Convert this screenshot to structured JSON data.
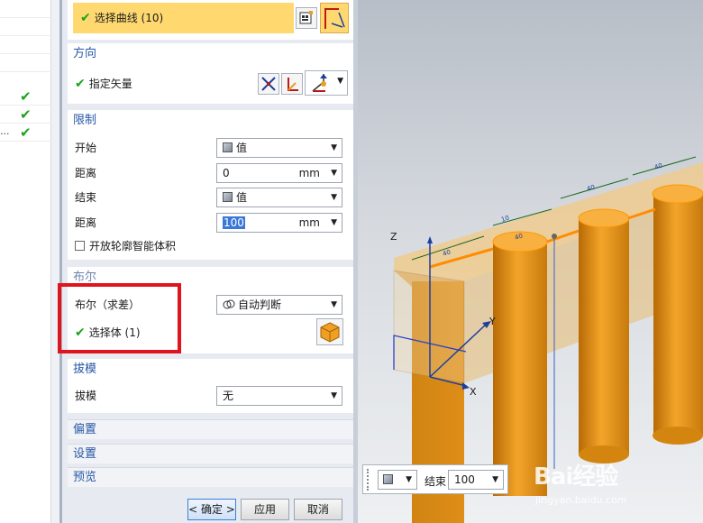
{
  "left_list": {
    "rows": [
      {
        "check": false,
        "text": ""
      },
      {
        "check": false,
        "text": ""
      },
      {
        "check": false,
        "text": ""
      },
      {
        "check": false,
        "text": ""
      },
      {
        "check": true,
        "text": ""
      },
      {
        "check": true,
        "text": ""
      },
      {
        "check": true,
        "text": "..."
      }
    ]
  },
  "section_top": {
    "select_curve_label": "选择曲线 (10)"
  },
  "direction": {
    "title": "方向",
    "specify_vector_label": "指定矢量"
  },
  "limits": {
    "title": "限制",
    "start_label": "开始",
    "start_value": "值",
    "distance1_label": "距离",
    "distance1_value": "0",
    "distance1_unit": "mm",
    "end_label": "结束",
    "end_value": "值",
    "distance2_label": "距离",
    "distance2_value": "100",
    "distance2_unit": "mm",
    "open_profile_label": "开放轮廓智能体积"
  },
  "boolean": {
    "title": "布尔",
    "boolean_label": "布尔（求差）",
    "boolean_value": "自动判断",
    "select_body_label": "选择体 (1)"
  },
  "draft": {
    "title": "拔模",
    "draft_label": "拔模",
    "draft_value": "无"
  },
  "collapsed_sections": {
    "offset": "偏置",
    "settings": "设置",
    "preview": "预览"
  },
  "buttons": {
    "ok": "< 确定 >",
    "apply": "应用",
    "cancel": "取消"
  },
  "viewport": {
    "axis_z": "Z",
    "axis_y": "Y",
    "axis_x": "X",
    "dims": [
      "40",
      "10",
      "40",
      "40",
      "40"
    ]
  },
  "bottom_toolbar": {
    "end_label": "结束",
    "end_value": "100"
  },
  "watermark": {
    "logo": "Bai经验",
    "url": "jingyan.baidu.com"
  },
  "colors": {
    "accent_blue": "#2858a6",
    "check_green": "#1aa31a",
    "highlight_red": "#e0141c",
    "selection_yellow": "#ffd970",
    "solid_orange": "#e08c10"
  }
}
